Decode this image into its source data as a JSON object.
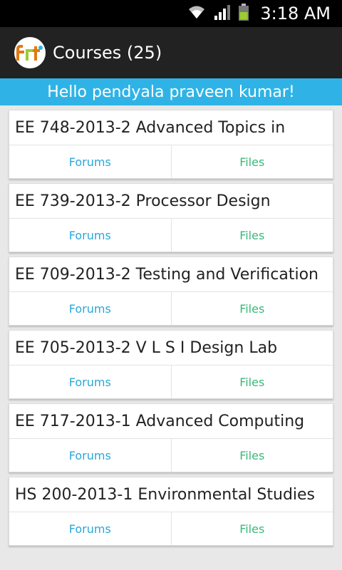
{
  "status": {
    "time": "3:18 AM"
  },
  "header": {
    "title": "Courses (25)"
  },
  "greeting": "Hello pendyala praveen kumar!",
  "courses": [
    {
      "title": "EE 748-2013-2 Advanced Topics in",
      "forums": "Forums",
      "files": "Files"
    },
    {
      "title": "EE 739-2013-2 Processor Design",
      "forums": "Forums",
      "files": "Files"
    },
    {
      "title": "EE 709-2013-2 Testing and Verification",
      "forums": "Forums",
      "files": "Files"
    },
    {
      "title": "EE 705-2013-2 V L S I Design Lab",
      "forums": "Forums",
      "files": "Files"
    },
    {
      "title": "EE 717-2013-1 Advanced Computing",
      "forums": "Forums",
      "files": "Files"
    },
    {
      "title": "HS 200-2013-1 Environmental Studies",
      "forums": "Forums",
      "files": "Files"
    }
  ],
  "colors": {
    "greeting_bg": "#2fb3e6",
    "forums_text": "#2aa7d8",
    "files_text": "#3bb87a",
    "actionbar_bg": "#222222"
  }
}
